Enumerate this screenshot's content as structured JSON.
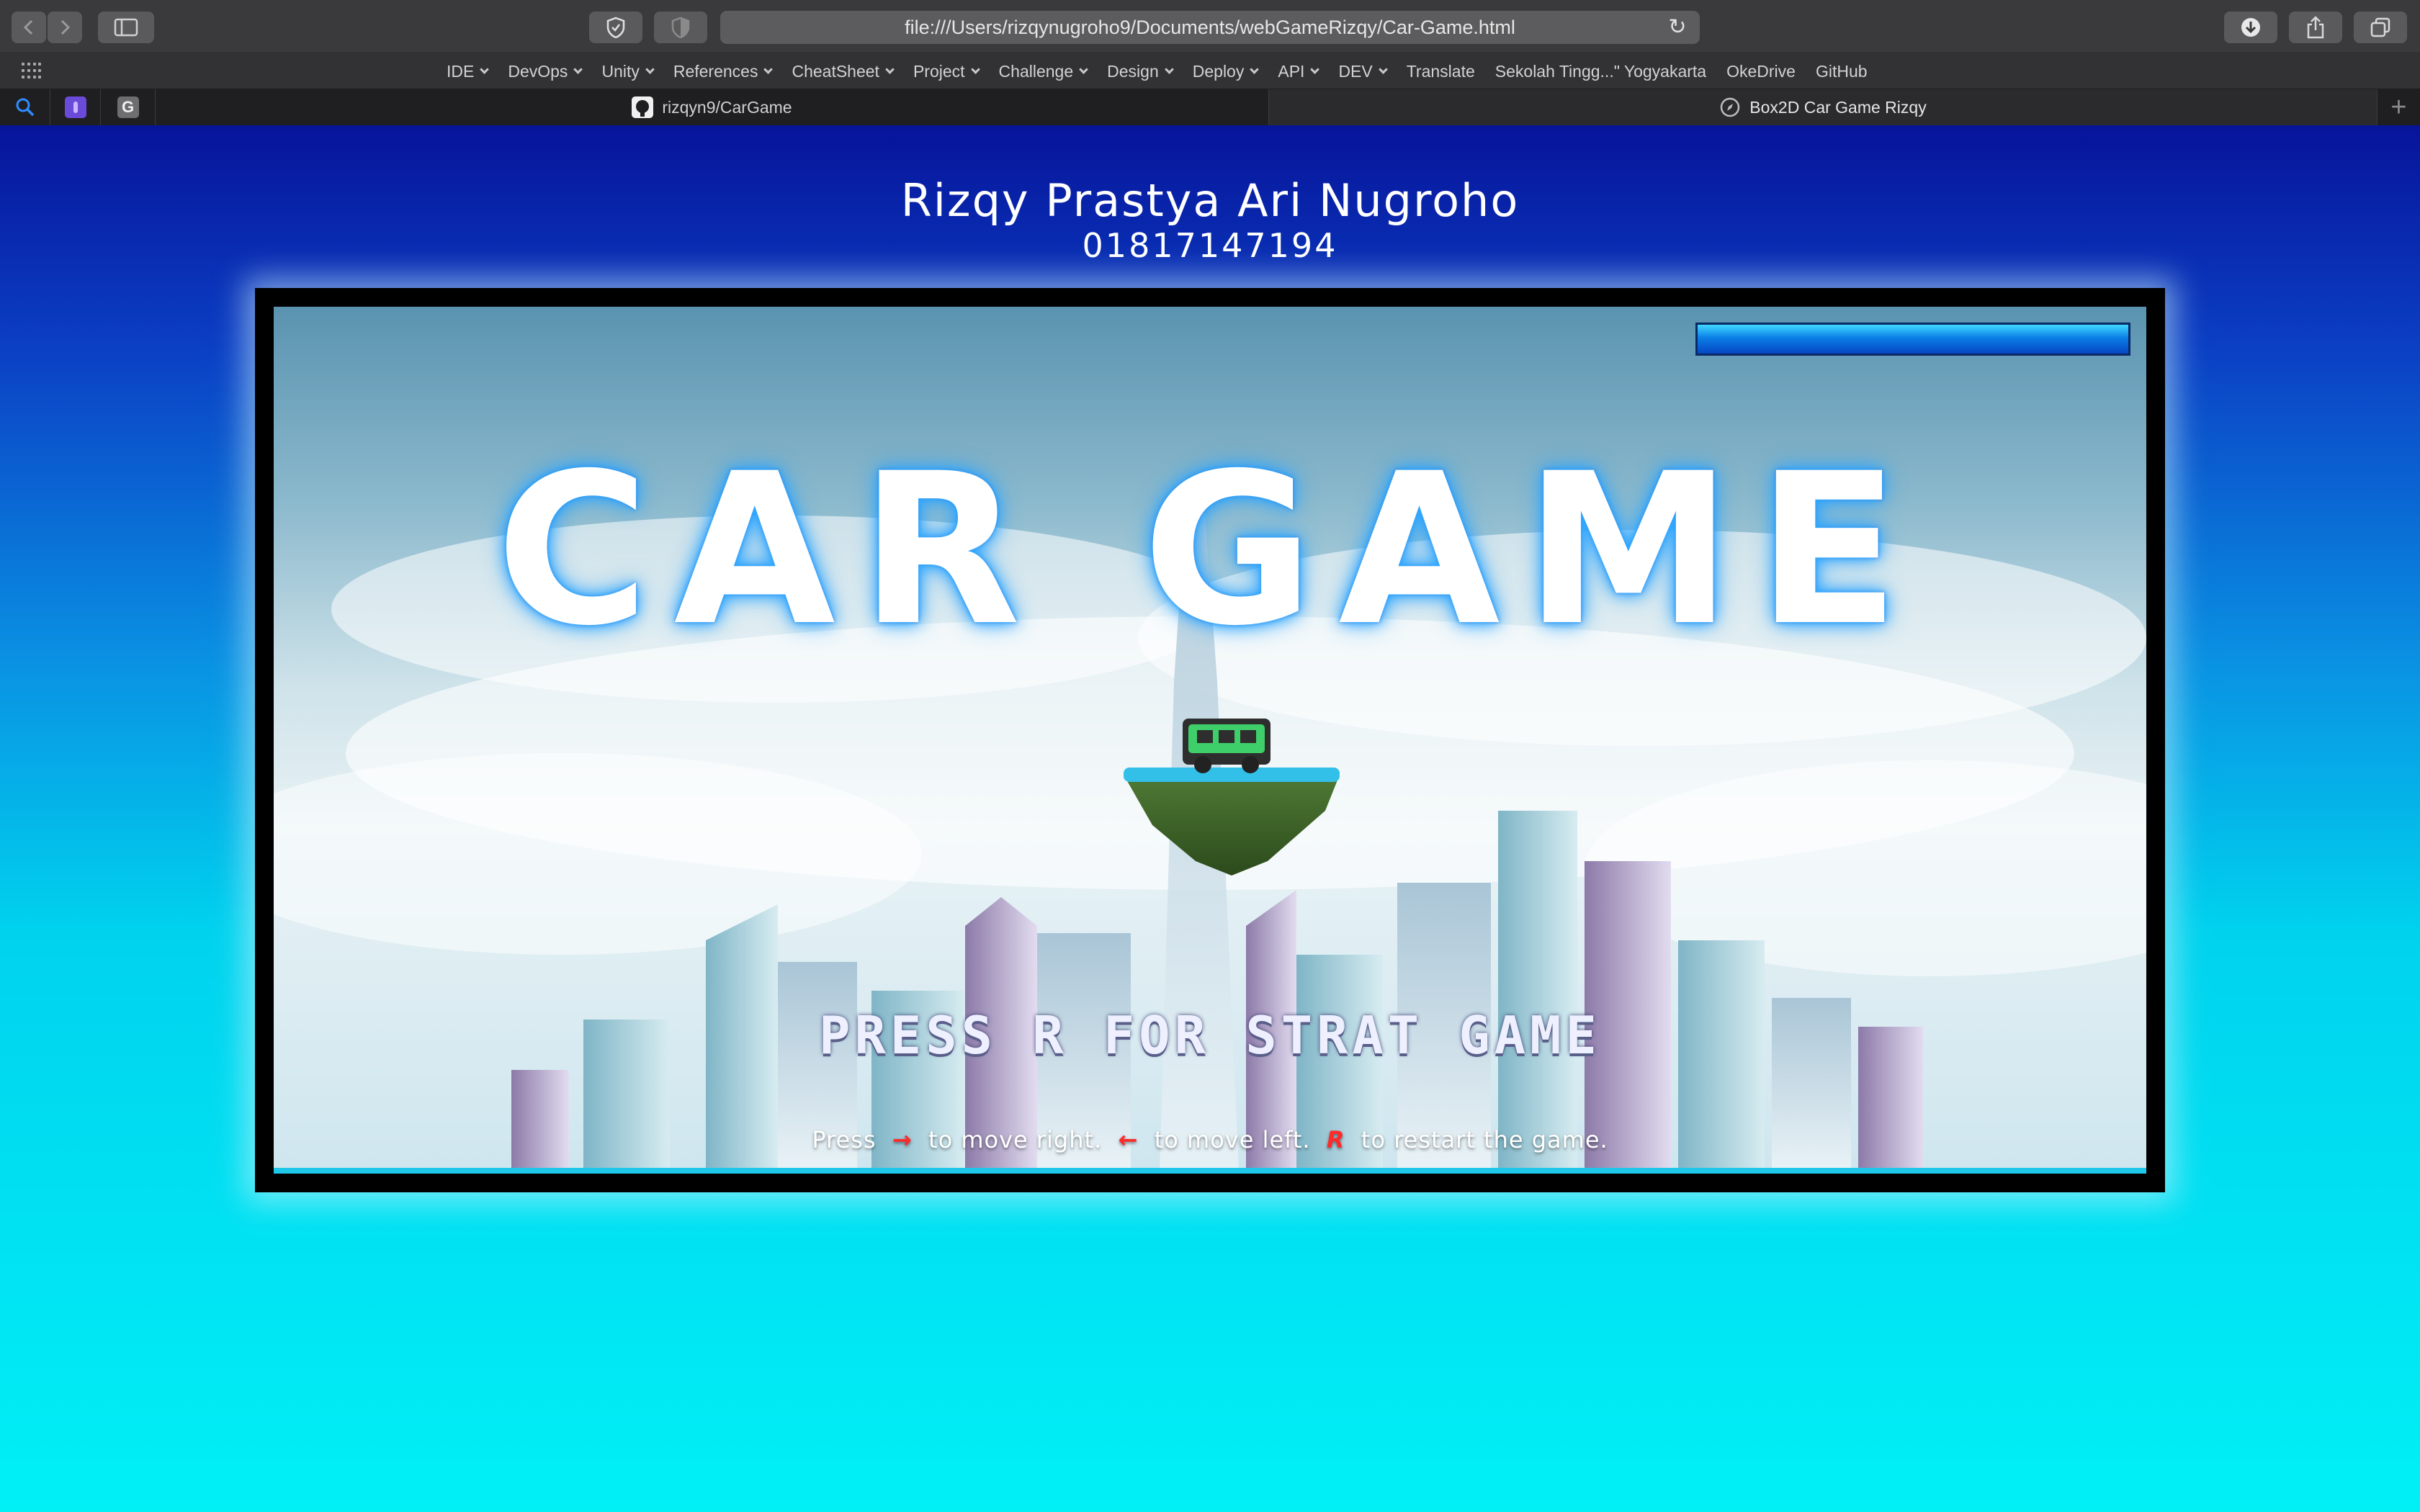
{
  "browser": {
    "url": "file:///Users/rizqynugroho9/Documents/webGameRizqy/Car-Game.html",
    "bookmarks": [
      {
        "label": "IDE",
        "menu": true
      },
      {
        "label": "DevOps",
        "menu": true
      },
      {
        "label": "Unity",
        "menu": true
      },
      {
        "label": "References",
        "menu": true
      },
      {
        "label": "CheatSheet",
        "menu": true
      },
      {
        "label": "Project",
        "menu": true
      },
      {
        "label": "Challenge",
        "menu": true
      },
      {
        "label": "Design",
        "menu": true
      },
      {
        "label": "Deploy",
        "menu": true
      },
      {
        "label": "API",
        "menu": true
      },
      {
        "label": "DEV",
        "menu": true
      },
      {
        "label": "Translate",
        "menu": false
      },
      {
        "label": "Sekolah Tingg...\" Yogyakarta",
        "menu": false
      },
      {
        "label": "OkeDrive",
        "menu": false
      },
      {
        "label": "GitHub",
        "menu": false
      }
    ],
    "tabs": [
      {
        "label": "rizqyn9/CarGame",
        "icon": "github-icon",
        "active": false
      },
      {
        "label": "Box2D Car Game Rizqy",
        "icon": "compass-icon",
        "active": true
      }
    ],
    "pinned_tab_letter": "G"
  },
  "page": {
    "title": "Rizqy Prastya Ari Nugroho",
    "student_id": "01817147194"
  },
  "game": {
    "logo": "CAR GAME",
    "start_prompt": "PRESS R FOR STRAT GAME",
    "energy_fraction": 1.0,
    "help": {
      "press": "Press",
      "right_key": "→",
      "right_text": "to move right.",
      "left_key": "←",
      "left_text": "to move left.",
      "restart_key": "R",
      "restart_text": "to restart the game."
    }
  },
  "colors": {
    "page_top": "#07149a",
    "page_bottom": "#00f0f6",
    "energy_bar": "#0b7fe6",
    "help_key": "#ff2a2a"
  }
}
